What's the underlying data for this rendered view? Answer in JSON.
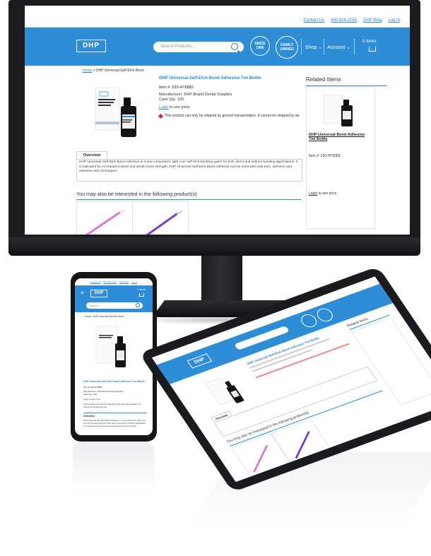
{
  "desktop": {
    "toplinks": [
      "Contact Us",
      "800.626.2163",
      "DHP Blog",
      "Log In"
    ],
    "logo": "DHP",
    "search_placeholder": "Search Products...",
    "badge_1": "SINCE 1996",
    "badge_2": "FAMILY OWNED",
    "nav": {
      "shop": "Shop",
      "account": "Account",
      "items": "0 Items"
    },
    "breadcrumb_home": "Home",
    "breadcrumb_rest": " > DHP Universal Self-Etch Bond",
    "product": {
      "title": "DHP Universal Self-Etch Bond Adhesive 7ml Bottle",
      "item_no": "Item #: 220-HT6882",
      "manufacturer": "Manufacturer: DHP Brand Dental Supplies",
      "case_qty": "Case Qty: 100",
      "login_link": "Login",
      "login_rest": " to see price.",
      "shipping_note": "This product can only be shipped by ground transportation. It cannot be shipped by air.",
      "box_text": "DHP"
    },
    "related": {
      "title": "Related Items",
      "name": "DHP Universal Bond Adhesive 7ml Bottle",
      "item_no": "Item #: 220-HT6083",
      "login_link": "Login",
      "login_rest": " to see price."
    },
    "overview": {
      "tab": "Overview",
      "text": "DHP Universal Self-Etch Bond Adhesive is a one-component, light cure self-etch bonding agent for both direct and indirect bonding applications. It is indicated for increased enamel and dentin bond strength. DHP Universal Self-Etch Bond Adhesive can be used with total etch, self-etch and selective etch techniques."
    },
    "also_title": "You may also be interested in the following product(s)"
  },
  "phone": {
    "toplinks": [
      "Contact Us",
      "800.626.2163",
      "DHP Blog",
      "Log In"
    ],
    "logo": "DHP",
    "items": "0 Items",
    "search_placeholder": "Search",
    "breadcrumb": "Home > DHP Universal Self-Etch Bond",
    "title": "DHP Universal Self-Etch Bond Adhesive 7ml Bottle",
    "item_no": "Item #: 220-HT6882",
    "manufacturer": "Manufacturer: DHP Brand Dental Supplies",
    "case_qty": "Case Qty: 100",
    "login": "Login to see price.",
    "shipping_note": "This product can only be shipped by ground transportation. It cannot be shipped by air.",
    "overview_tab": "Overview",
    "overview_text": "DHP Universal Self-Etch Bond Adhesive is a one-component, light cure self-etch bonding agent for both direct and indirect bonding applications. It is indicated for increased enamel and dentin bond strength."
  },
  "tablet": {
    "logo": "DHP",
    "title": "DHP Universal Self-Etch Bond Adhesive 7ml Bottle",
    "related_title": "Related Items",
    "overview_tab": "Overview",
    "also_title": "You may also be interested in the following product(s)"
  },
  "colors": {
    "brand_blue": "#2d8dd6",
    "link_blue": "#2f86d0",
    "alert_red": "#e4262c",
    "device_black": "#1a1b1e"
  }
}
